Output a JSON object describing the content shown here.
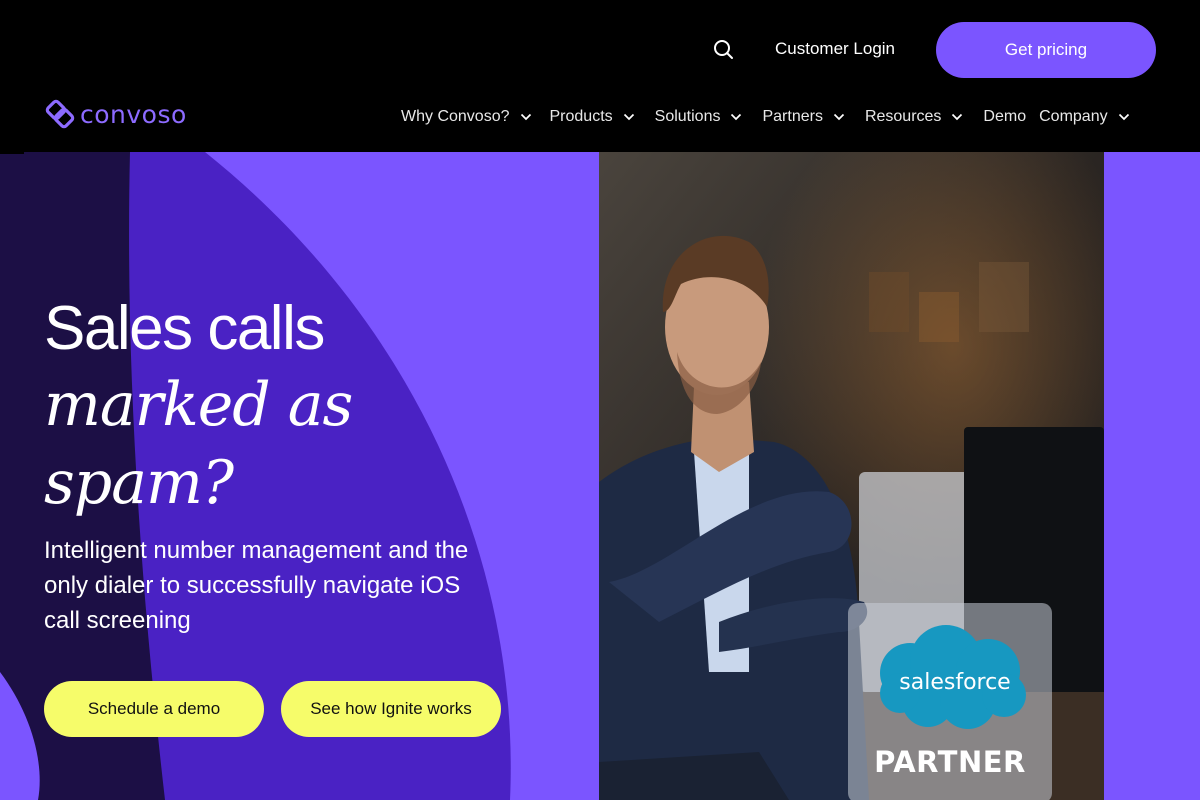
{
  "header": {
    "login_label": "Customer Login",
    "pricing_label": "Get pricing",
    "logo_text": "convoso",
    "nav": [
      {
        "label": "Why Convoso?",
        "has_menu": true
      },
      {
        "label": "Products",
        "has_menu": true
      },
      {
        "label": "Solutions",
        "has_menu": true
      },
      {
        "label": "Partners",
        "has_menu": true
      },
      {
        "label": "Resources",
        "has_menu": true
      },
      {
        "label": "Demo",
        "has_menu": false
      },
      {
        "label": "Company",
        "has_menu": true
      }
    ]
  },
  "hero": {
    "headline_line1": "Sales calls",
    "headline_line2": "marked as",
    "headline_line3": "spam?",
    "subheadline": "Intelligent number management and the only dialer to successfully navigate iOS call screening",
    "cta_primary": "Schedule a demo",
    "cta_secondary": "See how Ignite works",
    "badge": {
      "logo_text": "salesforce",
      "label": "PARTNER"
    }
  },
  "colors": {
    "brand_purple": "#7b55ff",
    "cta_yellow": "#f6fc6a",
    "header_bg": "#000000",
    "salesforce_blue": "#1798c1"
  },
  "icons": [
    "search-icon",
    "chevron-down-icon",
    "convoso-logo-icon",
    "salesforce-cloud-icon"
  ]
}
